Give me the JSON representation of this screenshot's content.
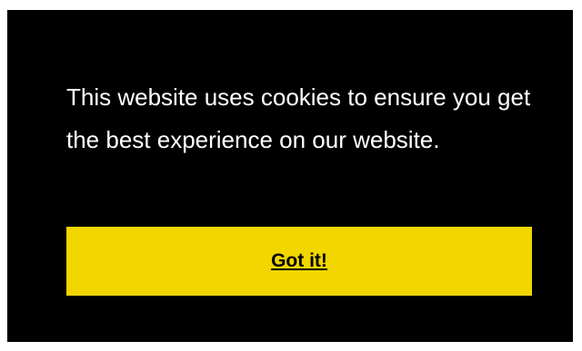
{
  "cookie_banner": {
    "message": "This website uses cookies to ensure you get the best experience on our website.",
    "accept_label": "Got it!"
  },
  "colors": {
    "banner_background": "#000000",
    "text": "#ffffff",
    "button_background": "#f1d600",
    "button_text": "#000000",
    "page_background": "#ffffff"
  }
}
